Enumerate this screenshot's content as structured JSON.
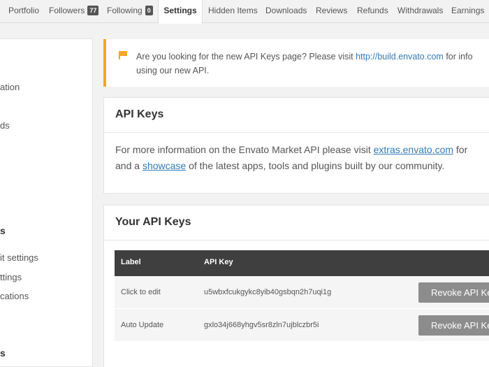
{
  "tabs": [
    {
      "label": "Portfolio"
    },
    {
      "label": "Followers",
      "count": "77"
    },
    {
      "label": "Following",
      "count": "0"
    },
    {
      "label": "Settings",
      "active": true
    },
    {
      "label": "Hidden Items"
    },
    {
      "label": "Downloads"
    },
    {
      "label": "Reviews"
    },
    {
      "label": "Refunds"
    },
    {
      "label": "Withdrawals"
    },
    {
      "label": "Earnings"
    }
  ],
  "sidebar": {
    "items": [
      "ation",
      "ds",
      "s",
      "it settings",
      "ttings",
      "cations",
      "s"
    ]
  },
  "notice": {
    "text_before": "Are you looking for the new API Keys page? Please visit ",
    "link": "http://build.envato.com",
    "text_after": " for info",
    "line2": "using our new API.",
    "accent_color": "#f5a623"
  },
  "api_keys_panel": {
    "title": "API Keys",
    "line1_before": "For more information on the Envato Market API please visit ",
    "line1_link": "extras.envato.com",
    "line1_after": " for ",
    "line2_before": "and a ",
    "line2_link": "showcase",
    "line2_after": " of the latest apps, tools and plugins built by our community."
  },
  "your_keys_panel": {
    "title": "Your API Keys",
    "columns": [
      "Label",
      "API Key"
    ],
    "rows": [
      {
        "label": "Click to edit",
        "key": "u5wbxfcukgykc8yib40gsbqn2h7uqi1g",
        "action": "Revoke API Key"
      },
      {
        "label": "Auto Update",
        "key": "gxlo34j668yhgv5sr8zln7ujblczbr5i",
        "action": "Revoke API Key"
      }
    ]
  }
}
